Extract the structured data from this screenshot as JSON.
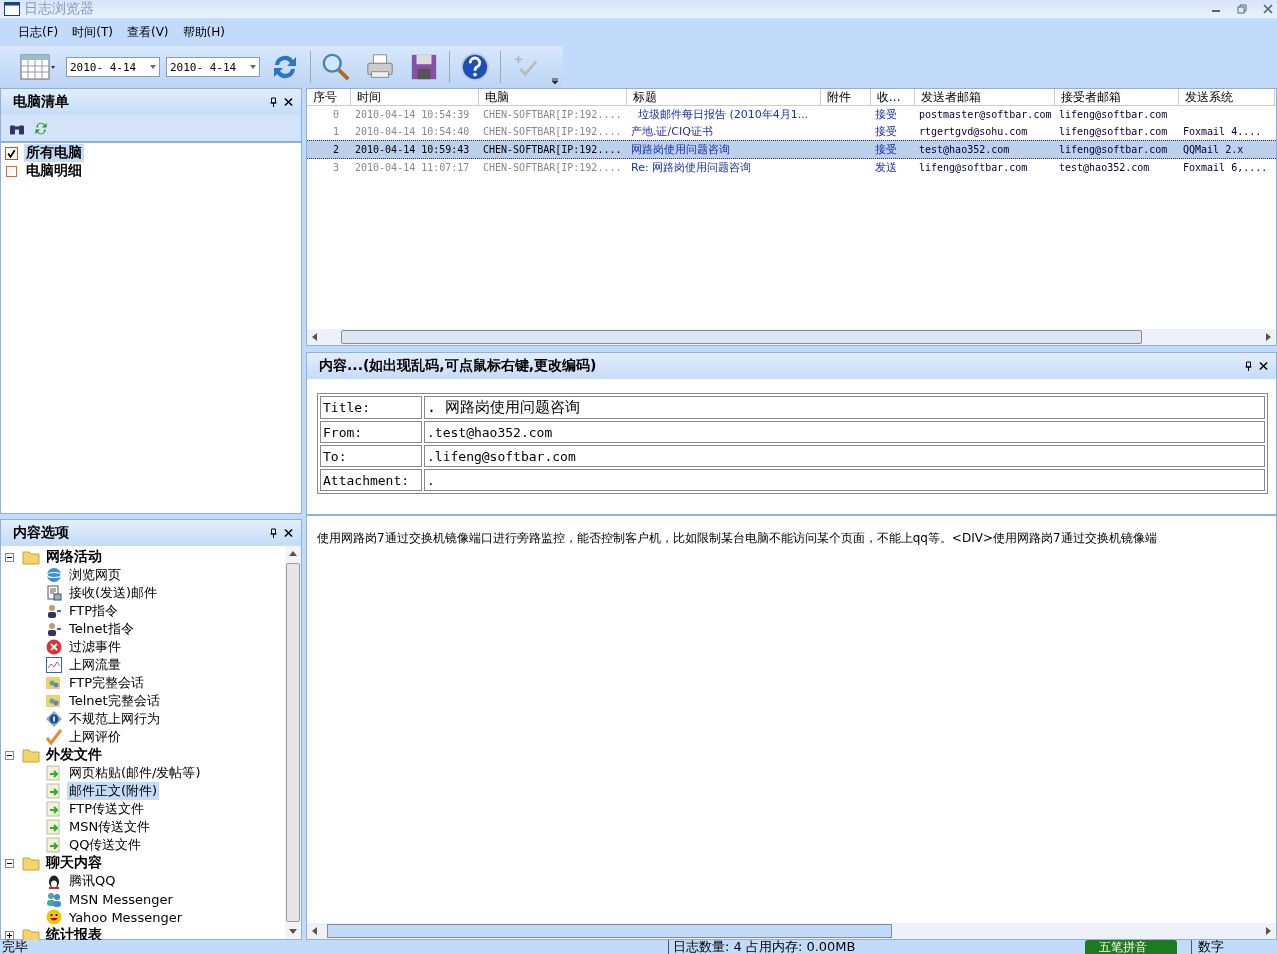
{
  "window": {
    "title": "日志浏览器"
  },
  "menu": [
    "日志(F)",
    "时间(T)",
    "查看(V)",
    "帮助(H)"
  ],
  "toolbar": {
    "date_from": "2010- 4-14",
    "date_to": "2010- 4-14"
  },
  "computer_panel": {
    "title": "电脑清单",
    "items": [
      {
        "label": "所有电脑",
        "kind": "checkbox",
        "checked": true,
        "selected": true
      },
      {
        "label": "电脑明细",
        "kind": "square",
        "checked": false,
        "selected": false
      }
    ]
  },
  "content_options": {
    "title": "内容选项",
    "tree": [
      {
        "label": "网络活动",
        "expanded": true,
        "selected": false,
        "children": [
          {
            "label": "浏览网页",
            "kind": "globe",
            "selected": false
          },
          {
            "label": "接收(发送)邮件",
            "kind": "document",
            "selected": false
          },
          {
            "label": "FTP指令",
            "kind": "user",
            "selected": false
          },
          {
            "label": "Telnet指令",
            "kind": "user",
            "selected": false
          },
          {
            "label": "过滤事件",
            "kind": "error",
            "selected": false
          },
          {
            "label": "上网流量",
            "kind": "chart",
            "selected": false
          },
          {
            "label": "FTP完整会话",
            "kind": "group",
            "selected": false
          },
          {
            "label": "Telnet完整会话",
            "kind": "group",
            "selected": false
          },
          {
            "label": "不规范上网行为",
            "kind": "info",
            "selected": false
          },
          {
            "label": "上网评价",
            "kind": "check",
            "selected": false
          }
        ]
      },
      {
        "label": "外发文件",
        "expanded": true,
        "selected": false,
        "children": [
          {
            "label": "网页粘贴(邮件/发帖等)",
            "kind": "arrow",
            "selected": false
          },
          {
            "label": "邮件正文(附件)",
            "kind": "arrow",
            "selected": true
          },
          {
            "label": "FTP传送文件",
            "kind": "arrow",
            "selected": false
          },
          {
            "label": "MSN传送文件",
            "kind": "arrow",
            "selected": false
          },
          {
            "label": "QQ传送文件",
            "kind": "arrow",
            "selected": false
          }
        ]
      },
      {
        "label": "聊天内容",
        "expanded": true,
        "selected": false,
        "children": [
          {
            "label": "腾讯QQ",
            "kind": "penguin",
            "selected": false
          },
          {
            "label": "MSN Messenger",
            "kind": "people",
            "selected": false
          },
          {
            "label": "Yahoo Messenger",
            "kind": "smiley",
            "selected": false
          }
        ]
      },
      {
        "label": "统计报表",
        "expanded": false,
        "selected": false
      }
    ]
  },
  "table": {
    "columns": [
      "序号",
      "时间",
      "电脑",
      "标题",
      "附件",
      "收...",
      "发送者邮箱",
      "接受者邮箱",
      "发送系统"
    ],
    "rows": [
      {
        "selected": false,
        "cells": [
          "0",
          "2010-04-14 10:54:39",
          "CHEN-SOFTBAR[IP:192....",
          "  垃圾邮件每日报告 (2010年4月1...",
          "",
          "接受",
          "postmaster@softbar.com",
          "lifeng@softbar.com",
          ""
        ]
      },
      {
        "selected": false,
        "cells": [
          "1",
          "2010-04-14 10:54:40",
          "CHEN-SOFTBAR[IP:192....",
          "产地.证/CIQ证书",
          "",
          "接受",
          "rtgertgvd@sohu.com",
          "lifeng@softbar.com",
          "Foxmail 4...."
        ]
      },
      {
        "selected": true,
        "cells": [
          "2",
          "2010-04-14 10:59:43",
          "CHEN-SOFTBAR[IP:192....",
          "网路岗使用问题咨询",
          "",
          "接受",
          "test@hao352.com",
          "lifeng@softbar.com",
          "QQMail 2.x"
        ]
      },
      {
        "selected": false,
        "cells": [
          "3",
          "2010-04-14 11:07:17",
          "CHEN-SOFTBAR[IP:192....",
          "Re: 网路岗使用问题咨询",
          "",
          "发送",
          "lifeng@softbar.com",
          "test@hao352.com",
          "Foxmail 6,...."
        ]
      }
    ]
  },
  "content_panel": {
    "title": "内容...(如出现乱码,可点鼠标右键,更改编码)",
    "fields": [
      {
        "label": "Title:",
        "value": ". 网路岗使用问题咨询"
      },
      {
        "label": "From:",
        "value": ".test@hao352.com"
      },
      {
        "label": "To:",
        "value": ".lifeng@softbar.com"
      },
      {
        "label": "Attachment:",
        "value": "."
      }
    ],
    "body": "使用网路岗7通过交换机镜像端口进行旁路监控，能否控制客户机，比如限制某台电脑不能访问某个页面，不能上qq等。<DIV>使用网路岗7通过交换机镜像端"
  },
  "status_bar": {
    "status": "完毕",
    "info": "日志数量: 4  占用内存: 0.00MB",
    "ime": "五笔拼音",
    "mode": "数字"
  }
}
